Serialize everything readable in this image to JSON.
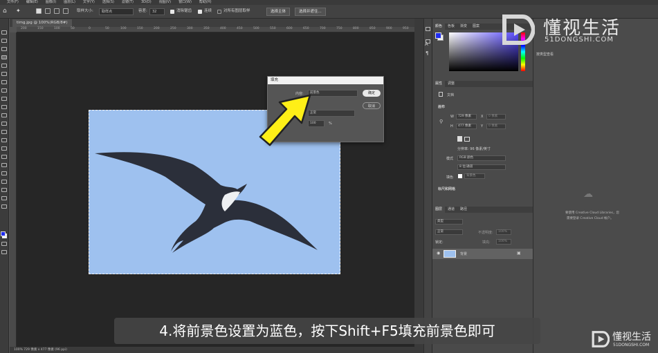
{
  "menubar": [
    "文件(F)",
    "编辑(E)",
    "图像(I)",
    "图层(L)",
    "文字(Y)",
    "选择(S)",
    "滤镜(T)",
    "3D(D)",
    "视图(V)",
    "窗口(W)",
    "帮助(H)"
  ],
  "options": {
    "sample_size_label": "取样大小:",
    "sample_size_value": "取样点",
    "tolerance_label": "容差:",
    "tolerance_value": "32",
    "anti_alias_label": "消除锯齿",
    "contiguous_label": "连续",
    "sample_all_label": "对所有图层取样",
    "select_subject": "选择主体",
    "select_and_mask": "选择并遮住..."
  },
  "document_tab": "timg.jpg @ 100%(RGB/8#)",
  "ruler_ticks": [
    "200",
    "150",
    "100",
    "50",
    "0",
    "50",
    "100",
    "150",
    "200",
    "250",
    "300",
    "350",
    "400",
    "450",
    "500",
    "550",
    "600",
    "650",
    "700",
    "750",
    "800",
    "850",
    "900",
    "950"
  ],
  "status_bar": "100%    729 像素 x 477 像素 (96 ppi)",
  "fill_dialog": {
    "title": "填充",
    "content_label": "内容:",
    "content_value": "前景色",
    "ok": "确定",
    "cancel": "取消",
    "mode_value": "正常",
    "opacity_value": "100",
    "opacity_unit": "%"
  },
  "color_panel": {
    "tabs": [
      "颜色",
      "色板",
      "渐变",
      "图案"
    ],
    "hue_color": "#5a4cff",
    "foreground": "#1f2cf0"
  },
  "properties_panel": {
    "tabs": [
      "属性",
      "调整"
    ],
    "doc_label": "文档",
    "canvas_header": "画布",
    "w_label": "W",
    "w_value": "729 像素",
    "h_label": "H",
    "h_value": "477 像素",
    "x_label": "X",
    "x_value": "0 像素",
    "y_label": "Y",
    "y_value": "0 像素",
    "resolution": "分辨率: 96 像素/英寸",
    "mode_label": "模式",
    "mode_value": "RGB 颜色",
    "bit_value": "8 位/通道",
    "fill_label": "填色",
    "fill_value": "背景色",
    "rulers_header": "标尺和网格"
  },
  "layers_panel": {
    "tabs": [
      "图层",
      "通道",
      "路径"
    ],
    "kind_placeholder": "类型",
    "blend_mode": "正常",
    "opacity_label": "不透明度:",
    "opacity_value": "100%",
    "lock_label": "锁定:",
    "fill_label": "填充:",
    "fill_value": "100%",
    "layer_name": "背景"
  },
  "library_panel": {
    "dropdown": "按类型查看",
    "message_line1": "要使用 Creative Cloud Libraries，您",
    "message_line2": "需要登录 Creative Cloud 帐户。"
  },
  "caption": "4.将前景色设置为蓝色，按下Shift+F5填充前景色即可",
  "watermark": {
    "brand": "懂视生活",
    "domain": "51DONGSHI.COM",
    "brand_small": "懂视生活",
    "domain_small": "51DONGSHI.COM"
  }
}
